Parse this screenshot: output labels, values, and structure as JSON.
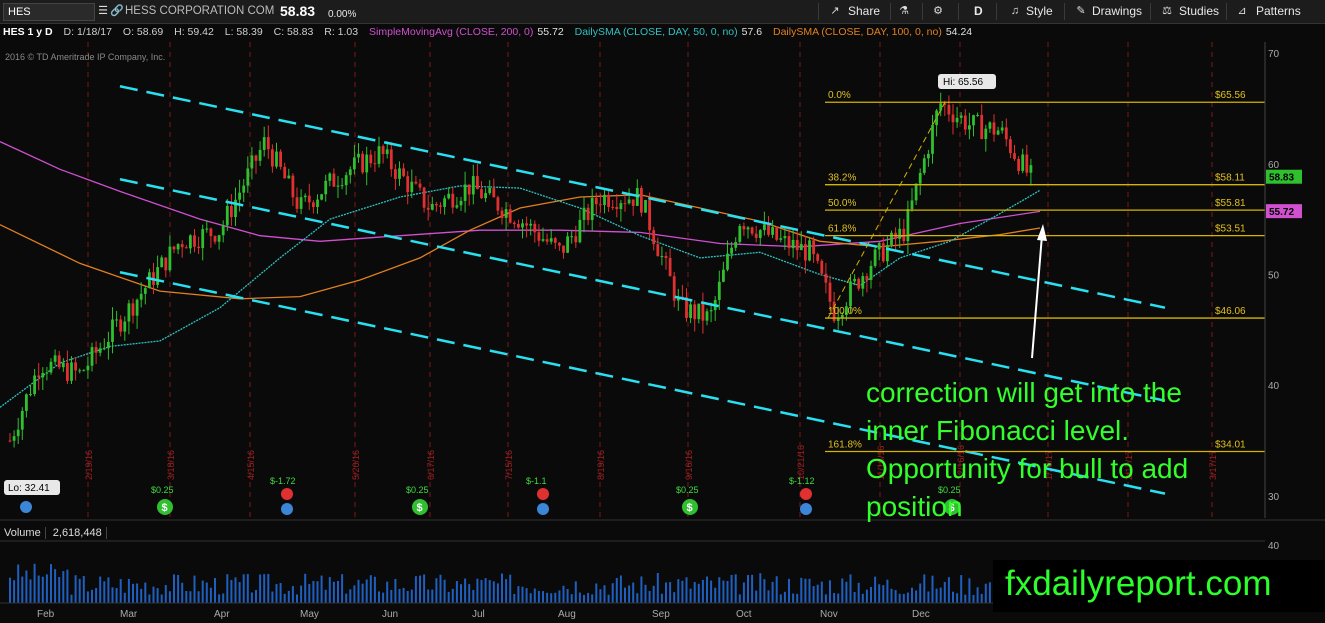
{
  "toolbar": {
    "symbol": "HES",
    "company": "HESS CORPORATION COM",
    "price": "58.83",
    "change": "0.00%",
    "share_label": "Share",
    "period_label": "D",
    "style_label": "Style",
    "drawings_label": "Drawings",
    "studies_label": "Studies",
    "patterns_label": "Patterns"
  },
  "studies": {
    "title": "HES 1 y D",
    "date": "D: 1/18/17",
    "open": "O: 58.69",
    "high": "H: 59.42",
    "low": "L: 58.39",
    "close": "C: 58.83",
    "range": "R: 1.03",
    "sma200": "SimpleMovingAvg (CLOSE, 200, 0)",
    "sma200_val": "55.72",
    "sma50": "DailySMA (CLOSE, DAY, 50, 0, no)",
    "sma50_val": "57.6",
    "sma100": "DailySMA (CLOSE, DAY, 100, 0, no)",
    "sma100_val": "54.24",
    "copyright": "2016 © TD Ameritrade IP Company, Inc."
  },
  "volume": {
    "label": "Volume",
    "value": "2,618,448"
  },
  "watermark": "fxdailyreport.com",
  "annotation": "correction will get into the inner Fibonacci level. Opportunity for bull to add position",
  "colors": {
    "fib": "#d4b400",
    "channel": "#29e0f0",
    "sma200": "#d050d0",
    "sma100": "#e08020",
    "sma50": "#30c0c0",
    "up": "#2fbf2f",
    "down": "#e03030",
    "annotation": "#33ff2c"
  },
  "chart_data": {
    "type": "candlestick",
    "title": "HES 1 y D",
    "months": [
      "Feb",
      "Mar",
      "Apr",
      "May",
      "Jun",
      "Jul",
      "Aug",
      "Sep",
      "Oct",
      "Nov",
      "Dec"
    ],
    "price_axis_ticks": [
      30,
      40,
      50,
      60,
      70
    ],
    "ylim": [
      28,
      71
    ],
    "volume_axis_ticks": [
      40
    ],
    "high_label": "Hi: 65.56",
    "low_label": "Lo: 32.41",
    "current_price": 58.83,
    "current_label": "58.83",
    "sma200_label": "55.72",
    "fibonacci": [
      {
        "level": "0.0%",
        "price": 65.56,
        "label": "$65.56"
      },
      {
        "level": "38.2%",
        "price": 58.11,
        "label": "$58.11"
      },
      {
        "level": "50.0%",
        "price": 55.81,
        "label": "$55.81"
      },
      {
        "level": "61.8%",
        "price": 53.51,
        "label": "$53.51"
      },
      {
        "level": "100.0%",
        "price": 46.06,
        "label": "$46.06"
      },
      {
        "level": "161.8%",
        "price": 34.01,
        "label": "$34.01"
      }
    ],
    "dividend_events": [
      "$0.25",
      "$0.25",
      "$0.25",
      "$0.25"
    ],
    "earnings_events": [
      "$-1.72",
      "$-1.1",
      "$-1.12"
    ],
    "vertical_date_labels": [
      "2/19/16",
      "3/18/16",
      "4/15/16",
      "5/20/16",
      "6/17/16",
      "7/15/16",
      "8/19/16",
      "9/16/16",
      "10/21/16",
      "11/18/16",
      "12/16/16",
      "1/20/17",
      "2/17/17",
      "3/17/17"
    ]
  }
}
